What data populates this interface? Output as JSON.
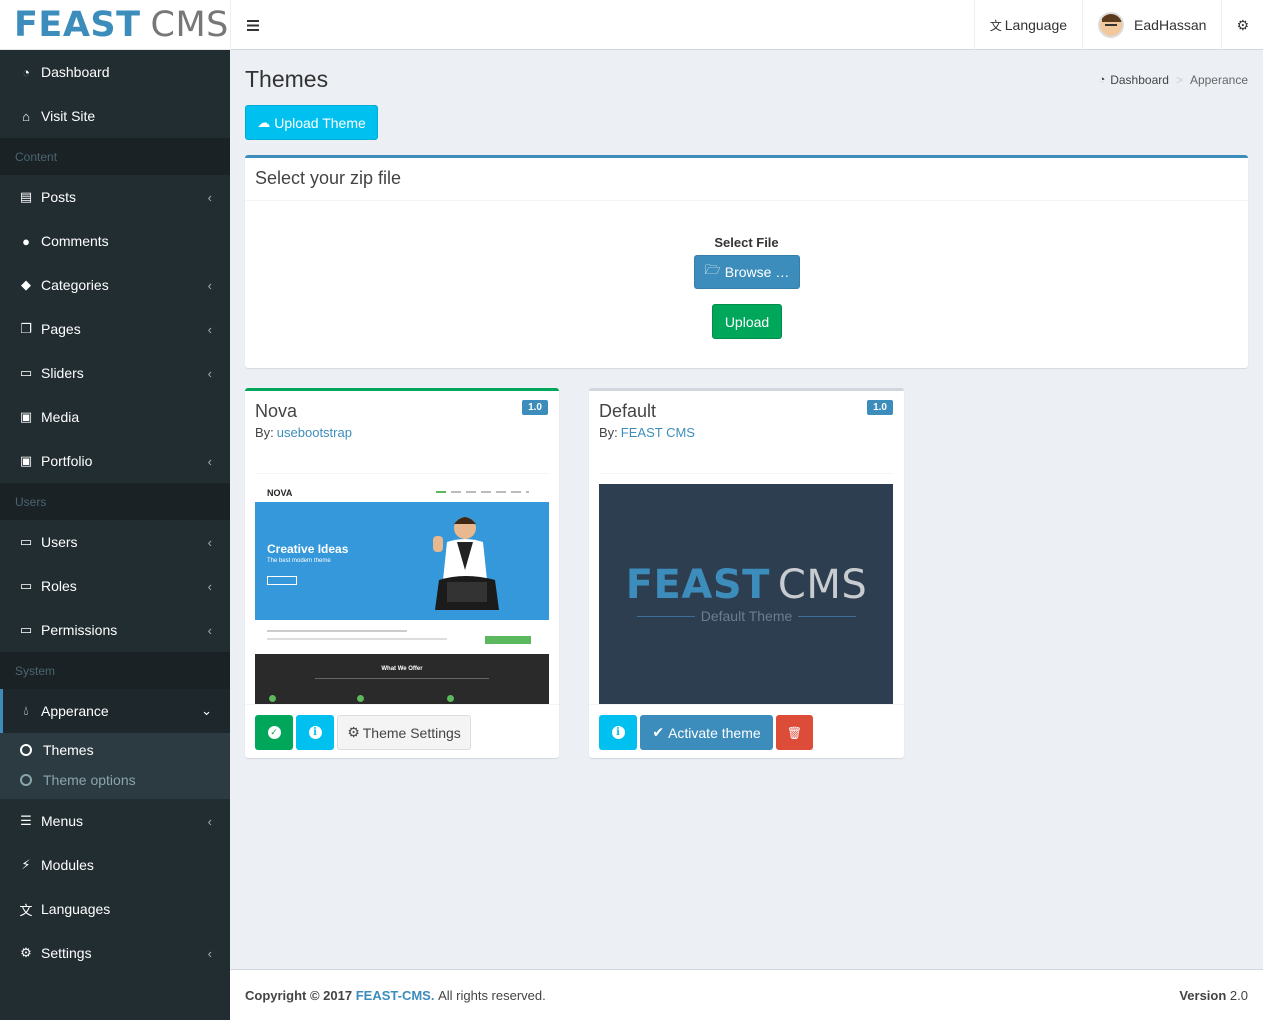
{
  "logo": {
    "part1": "FEAST",
    "part2": "CMS"
  },
  "topbar": {
    "toggle_icon": "bars-icon",
    "language_label": "Language",
    "user_name": "EadHassan",
    "settings_icon": "gears-icon"
  },
  "sidebar": {
    "items": [
      {
        "label": "Dashboard",
        "icon": "dashboard-icon"
      },
      {
        "label": "Visit Site",
        "icon": "home-icon"
      }
    ],
    "content_header": "Content",
    "content_items": [
      {
        "label": "Posts",
        "icon": "file-icon"
      },
      {
        "label": "Comments",
        "icon": "comment-icon"
      },
      {
        "label": "Categories",
        "icon": "tags-icon"
      },
      {
        "label": "Pages",
        "icon": "copy-icon"
      },
      {
        "label": "Sliders",
        "icon": "desktop-icon"
      },
      {
        "label": "Media",
        "icon": "image-icon"
      },
      {
        "label": "Portfolio",
        "icon": "image-icon"
      }
    ],
    "users_header": "Users",
    "users_items": [
      {
        "label": "Users",
        "icon": "desktop-icon"
      },
      {
        "label": "Roles",
        "icon": "desktop-icon"
      },
      {
        "label": "Permissions",
        "icon": "desktop-icon"
      }
    ],
    "system_header": "System",
    "appearance": "Apperance",
    "sub": {
      "themes": "Themes",
      "theme_options": "Theme options"
    },
    "system_items": [
      {
        "label": "Menus",
        "icon": "bars-icon"
      },
      {
        "label": "Modules",
        "icon": "plug-icon"
      },
      {
        "label": "Languages",
        "icon": "language-icon"
      },
      {
        "label": "Settings",
        "icon": "gears-icon"
      }
    ]
  },
  "page": {
    "title": "Themes",
    "breadcrumb": {
      "home": "Dashboard",
      "current": "Apperance"
    },
    "upload_theme_label": "Upload Theme"
  },
  "upload_box": {
    "title": "Select your zip file",
    "select_file_label": "Select File",
    "browse_label": "Browse …",
    "upload_label": "Upload"
  },
  "themes": {
    "nova": {
      "name": "Nova",
      "by_label": "By:",
      "author": "usebootstrap",
      "version": "1.0",
      "settings_label": "Theme Settings",
      "preview": {
        "logo": "NOVA",
        "headline": "Creative Ideas",
        "subline": "The best modern theme",
        "offer": "What We Offer"
      }
    },
    "default": {
      "name": "Default",
      "by_label": "By:",
      "author": "FEAST CMS",
      "version": "1.0",
      "activate_label": "Activate theme",
      "preview": {
        "logo1": "FEAST",
        "logo2": "CMS",
        "subtitle": "Default Theme"
      }
    }
  },
  "footer": {
    "copyright": "Copyright © 2017",
    "brand": "FEAST-CMS.",
    "rights": "All rights reserved.",
    "version_label": "Version",
    "version": "2.0"
  }
}
